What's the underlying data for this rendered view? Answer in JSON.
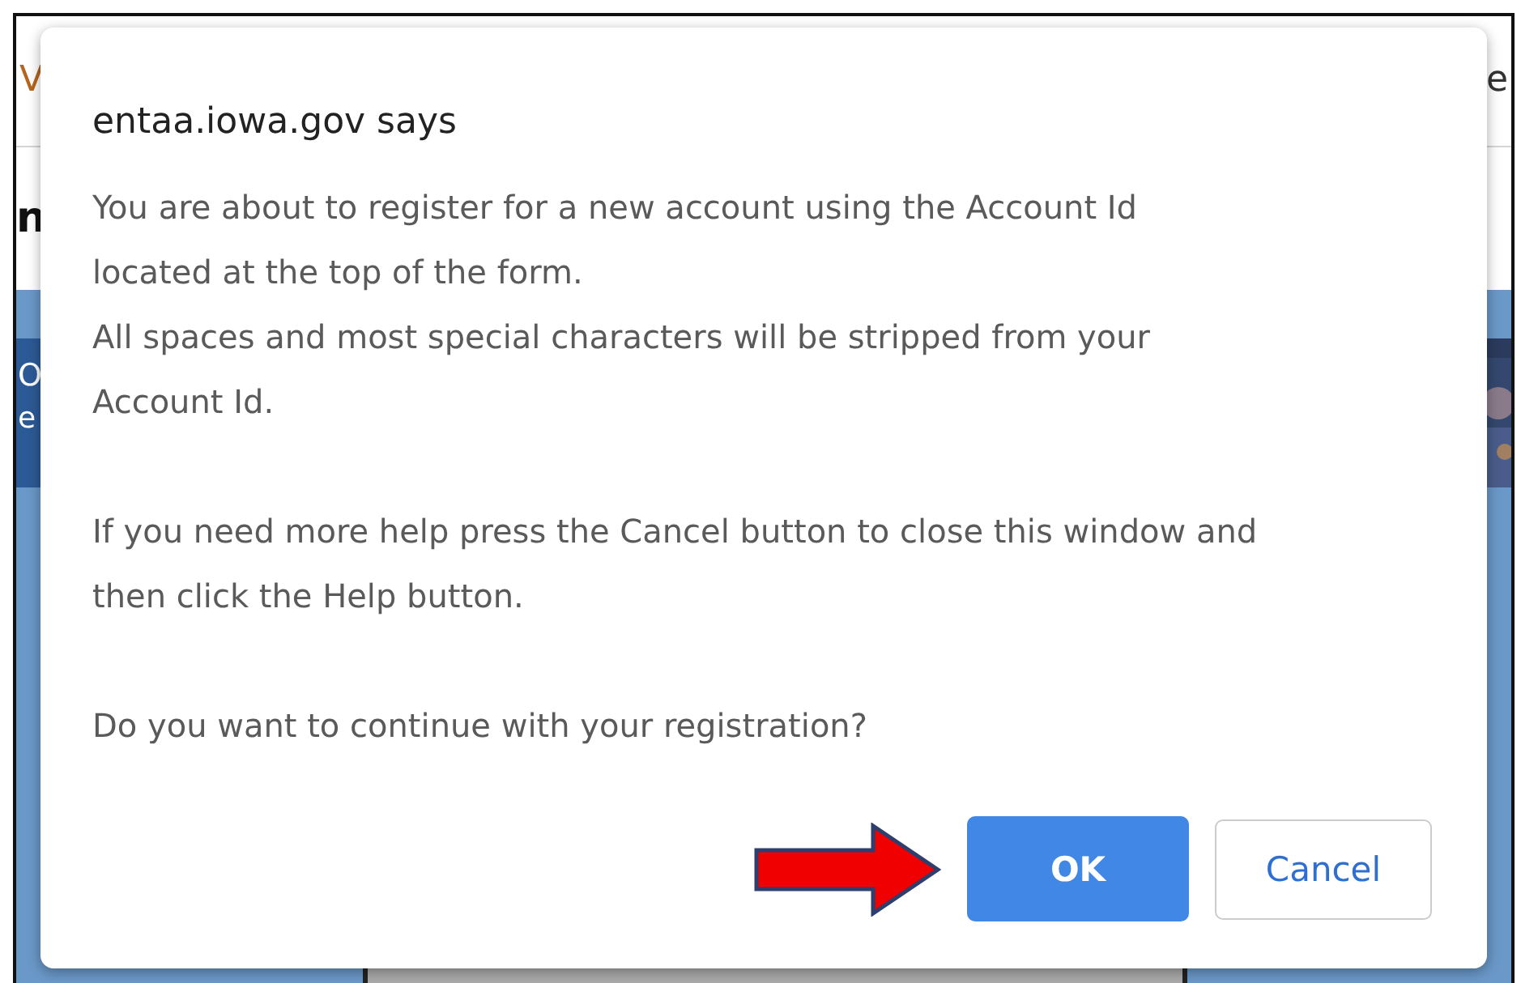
{
  "background": {
    "top_left_text": "V",
    "top_right_text": "e",
    "heading_text": "n",
    "banner_text": "O",
    "banner_subtext": "e"
  },
  "dialog": {
    "title": "entaa.iowa.gov says",
    "paragraphs": [
      [
        "You are about to register for a new account using the Account Id",
        "located at the top of the form.",
        "All spaces and most special characters will be stripped from your",
        "Account Id."
      ],
      [
        "If you need more help press the Cancel button to close this window and",
        "then click the Help button."
      ],
      [
        "Do you want to continue with your registration?"
      ]
    ],
    "buttons": [
      {
        "label": "OK",
        "kind": "primary",
        "pointed_at": true
      },
      {
        "label": "Cancel",
        "kind": "secondary",
        "pointed_at": false
      }
    ]
  }
}
